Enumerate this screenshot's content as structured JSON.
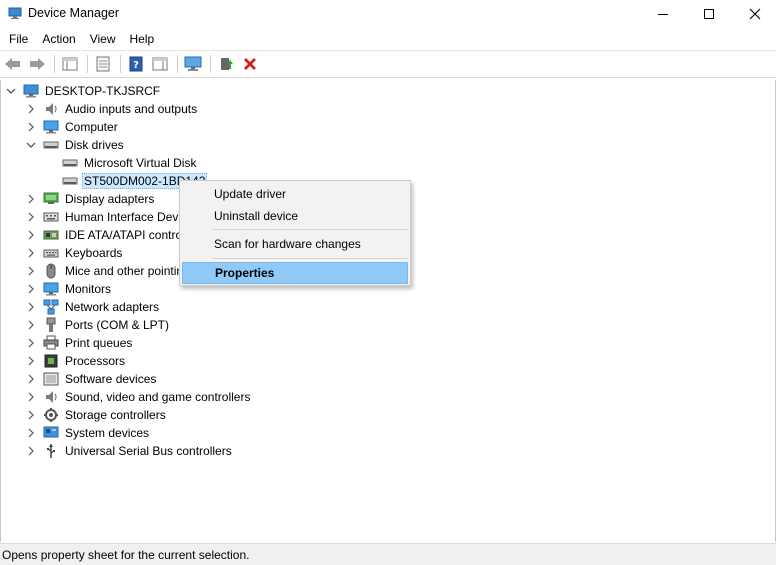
{
  "window": {
    "title": "Device Manager"
  },
  "menu": [
    "File",
    "Action",
    "View",
    "Help"
  ],
  "tree": {
    "root": "DESKTOP-TKJSRCF",
    "categories": [
      "Audio inputs and outputs",
      "Computer",
      "Disk drives",
      "Display adapters",
      "Human Interface Devi",
      "IDE ATA/ATAPI control",
      "Keyboards",
      "Mice and other pointin",
      "Monitors",
      "Network adapters",
      "Ports (COM & LPT)",
      "Print queues",
      "Processors",
      "Software devices",
      "Sound, video and game controllers",
      "Storage controllers",
      "System devices",
      "Universal Serial Bus controllers"
    ],
    "disk_children": [
      "Microsoft Virtual Disk",
      "ST500DM002-1BD142"
    ]
  },
  "context_menu": {
    "update": "Update driver",
    "uninstall": "Uninstall device",
    "scan": "Scan for hardware changes",
    "properties": "Properties"
  },
  "status": {
    "text": "Opens property sheet for the current selection."
  },
  "icons": {
    "app": "device-manager-icon",
    "back": "back-arrow-icon",
    "forward": "forward-arrow-icon",
    "delete": "red-x-icon"
  }
}
